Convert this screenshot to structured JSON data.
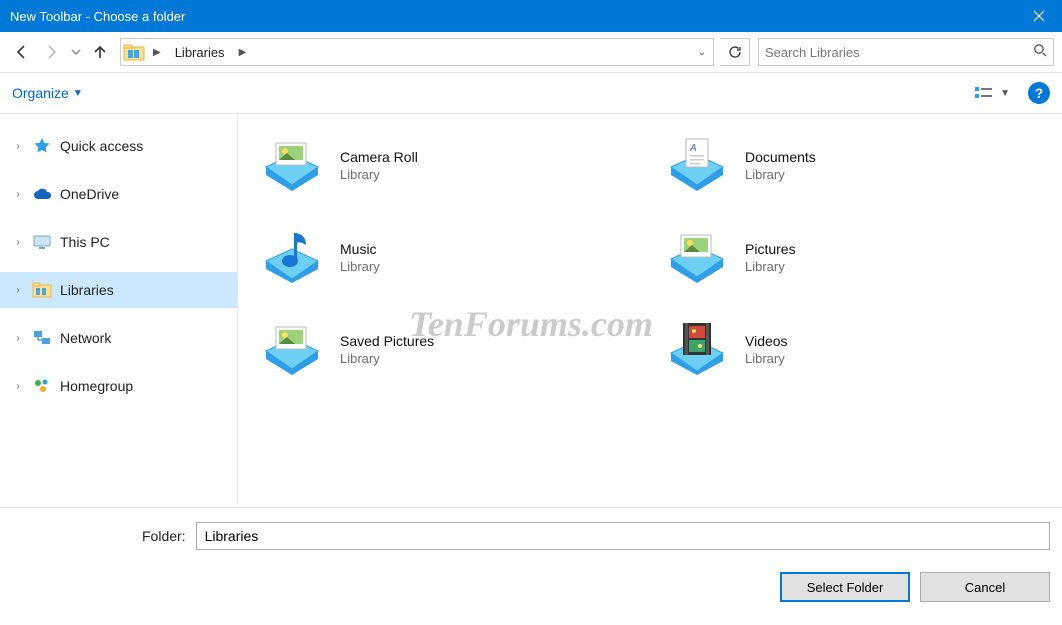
{
  "window": {
    "title": "New Toolbar - Choose a folder"
  },
  "breadcrumb": {
    "segment": "Libraries"
  },
  "search": {
    "placeholder": "Search Libraries"
  },
  "cmdbar": {
    "organize": "Organize"
  },
  "tree": {
    "items": [
      {
        "label": "Quick access"
      },
      {
        "label": "OneDrive"
      },
      {
        "label": "This PC"
      },
      {
        "label": "Libraries"
      },
      {
        "label": "Network"
      },
      {
        "label": "Homegroup"
      }
    ]
  },
  "libraries": {
    "subtitle": "Library",
    "items": [
      {
        "name": "Camera Roll"
      },
      {
        "name": "Documents"
      },
      {
        "name": "Music"
      },
      {
        "name": "Pictures"
      },
      {
        "name": "Saved Pictures"
      },
      {
        "name": "Videos"
      }
    ]
  },
  "bottom": {
    "folder_label": "Folder:",
    "folder_value": "Libraries",
    "select": "Select Folder",
    "cancel": "Cancel"
  },
  "watermark": "TenForums.com"
}
